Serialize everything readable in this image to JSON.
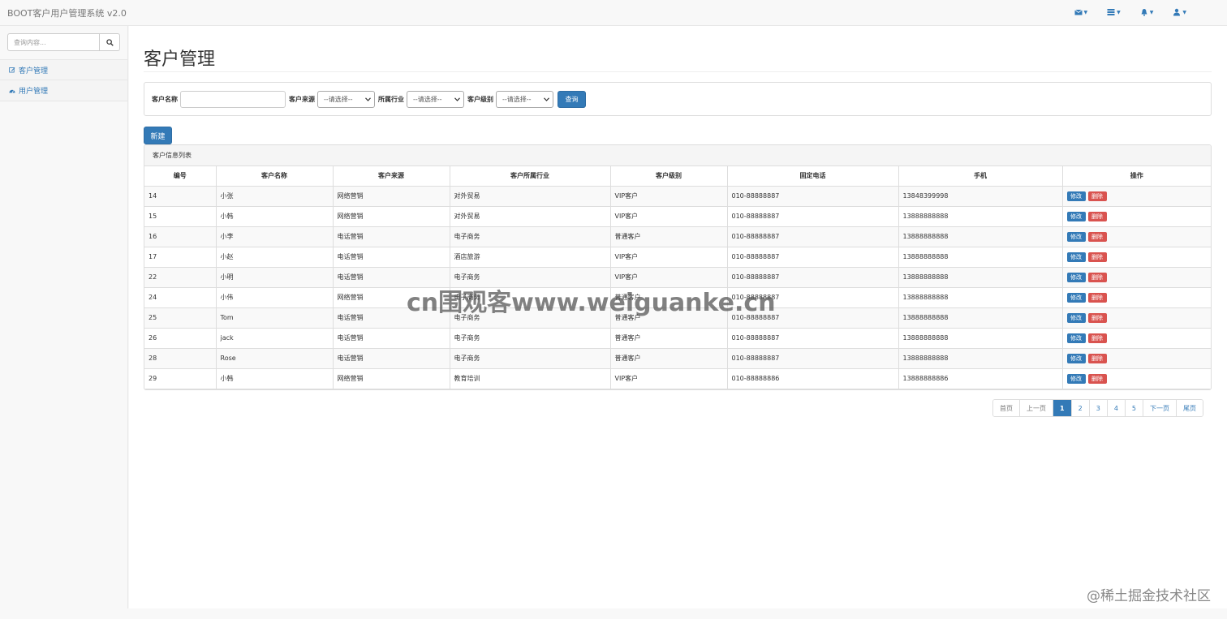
{
  "app": {
    "title": "BOOT客户用户管理系统 v2.0"
  },
  "nav_icons": [
    "envelope-icon",
    "tasks-icon",
    "bell-icon",
    "user-icon"
  ],
  "sidebar": {
    "search_placeholder": "查询内容...",
    "items": [
      {
        "label": "客户管理",
        "icon": "edit-icon"
      },
      {
        "label": "用户管理",
        "icon": "dashboard-icon"
      }
    ]
  },
  "main": {
    "title": "客户管理",
    "filter": {
      "name_label": "客户名称",
      "name_value": "",
      "source_label": "客户来源",
      "source_value": "--请选择--",
      "industry_label": "所属行业",
      "industry_value": "--请选择--",
      "level_label": "客户级别",
      "level_value": "--请选择--",
      "query_button": "查询"
    },
    "new_button": "新建",
    "list_title": "客户信息列表",
    "table": {
      "headers": [
        "编号",
        "客户名称",
        "客户来源",
        "客户所属行业",
        "客户级别",
        "固定电话",
        "手机",
        "操作"
      ],
      "edit_label": "修改",
      "delete_label": "删除",
      "rows": [
        [
          "14",
          "小张",
          "网络营销",
          "对外贸易",
          "VIP客户",
          "010-88888887",
          "13848399998"
        ],
        [
          "15",
          "小韩",
          "网络营销",
          "对外贸易",
          "VIP客户",
          "010-88888887",
          "13888888888"
        ],
        [
          "16",
          "小李",
          "电话营销",
          "电子商务",
          "普通客户",
          "010-88888887",
          "13888888888"
        ],
        [
          "17",
          "小赵",
          "电话营销",
          "酒店旅游",
          "VIP客户",
          "010-88888887",
          "13888888888"
        ],
        [
          "22",
          "小明",
          "电话营销",
          "电子商务",
          "VIP客户",
          "010-88888887",
          "13888888888"
        ],
        [
          "24",
          "小伟",
          "网络营销",
          "电子商务",
          "普通客户",
          "010-88888887",
          "13888888888"
        ],
        [
          "25",
          "Tom",
          "电话营销",
          "电子商务",
          "普通客户",
          "010-88888887",
          "13888888888"
        ],
        [
          "26",
          "jack",
          "电话营销",
          "电子商务",
          "普通客户",
          "010-88888887",
          "13888888888"
        ],
        [
          "28",
          "Rose",
          "电话营销",
          "电子商务",
          "普通客户",
          "010-88888887",
          "13888888888"
        ],
        [
          "29",
          "小韩",
          "网络营销",
          "教育培训",
          "VIP客户",
          "010-88888886",
          "13888888886"
        ]
      ]
    },
    "pagination": {
      "first": "首页",
      "prev": "上一页",
      "pages": [
        "1",
        "2",
        "3",
        "4",
        "5"
      ],
      "active_page": "1",
      "next": "下一页",
      "last": "尾页"
    }
  },
  "watermark": "cn围观客www.weiguanke.cn",
  "footer_watermark": "@稀土掘金技术社区",
  "colors": {
    "primary": "#337ab7",
    "danger": "#d9534f",
    "border": "#dddddd"
  }
}
